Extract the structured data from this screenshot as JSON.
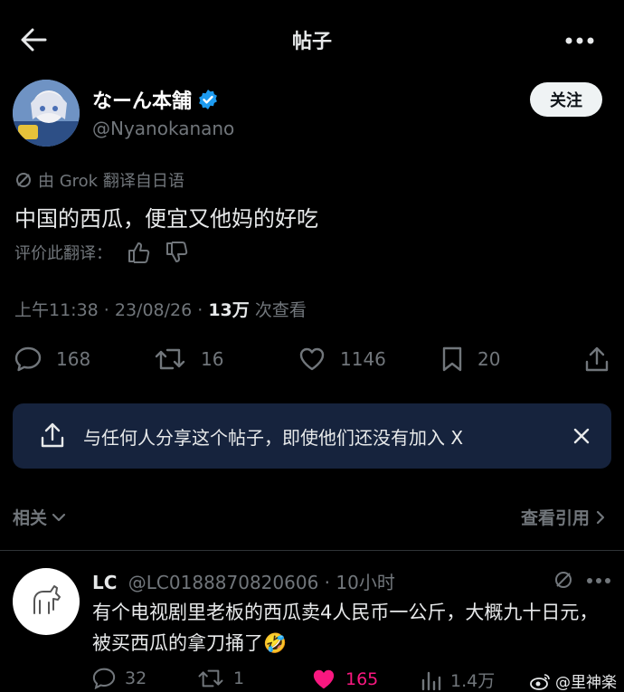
{
  "header": {
    "title": "帖子"
  },
  "author": {
    "name": "なーん本舗",
    "handle": "@Nyanokanano",
    "follow_label": "关注"
  },
  "translation": {
    "note": "由 Grok 翻译自日语",
    "text": "中国的西瓜，便宜又他妈的好吃",
    "rate_label": "评价此翻译："
  },
  "meta": {
    "time_date": "上午11:38 · 23/08/26 · ",
    "views": "13万",
    "views_label": " 次查看"
  },
  "actions": {
    "replies": "168",
    "reposts": "16",
    "likes": "1146",
    "bookmarks": "20"
  },
  "share_banner": {
    "text": "与任何人分享这个帖子，即使他们还没有加入 X"
  },
  "related": {
    "label": "相关",
    "quotes_label": "查看引用"
  },
  "reply": {
    "name": "LC",
    "handle_time": "@LC0188870820606 · 10小时",
    "text": "有个电视剧里老板的西瓜卖4人民币一公斤，大概九十日元，被买西瓜的拿刀捅了🤣",
    "replies": "32",
    "reposts": "1",
    "likes": "165",
    "views": "1.4万"
  },
  "watermark": {
    "text": "@里神楽"
  },
  "colors": {
    "background": "#000000",
    "text": "#e7e9ea",
    "muted": "#71767b",
    "verified": "#1d9bf0",
    "like_active": "#f91880",
    "banner": "#16233d"
  }
}
